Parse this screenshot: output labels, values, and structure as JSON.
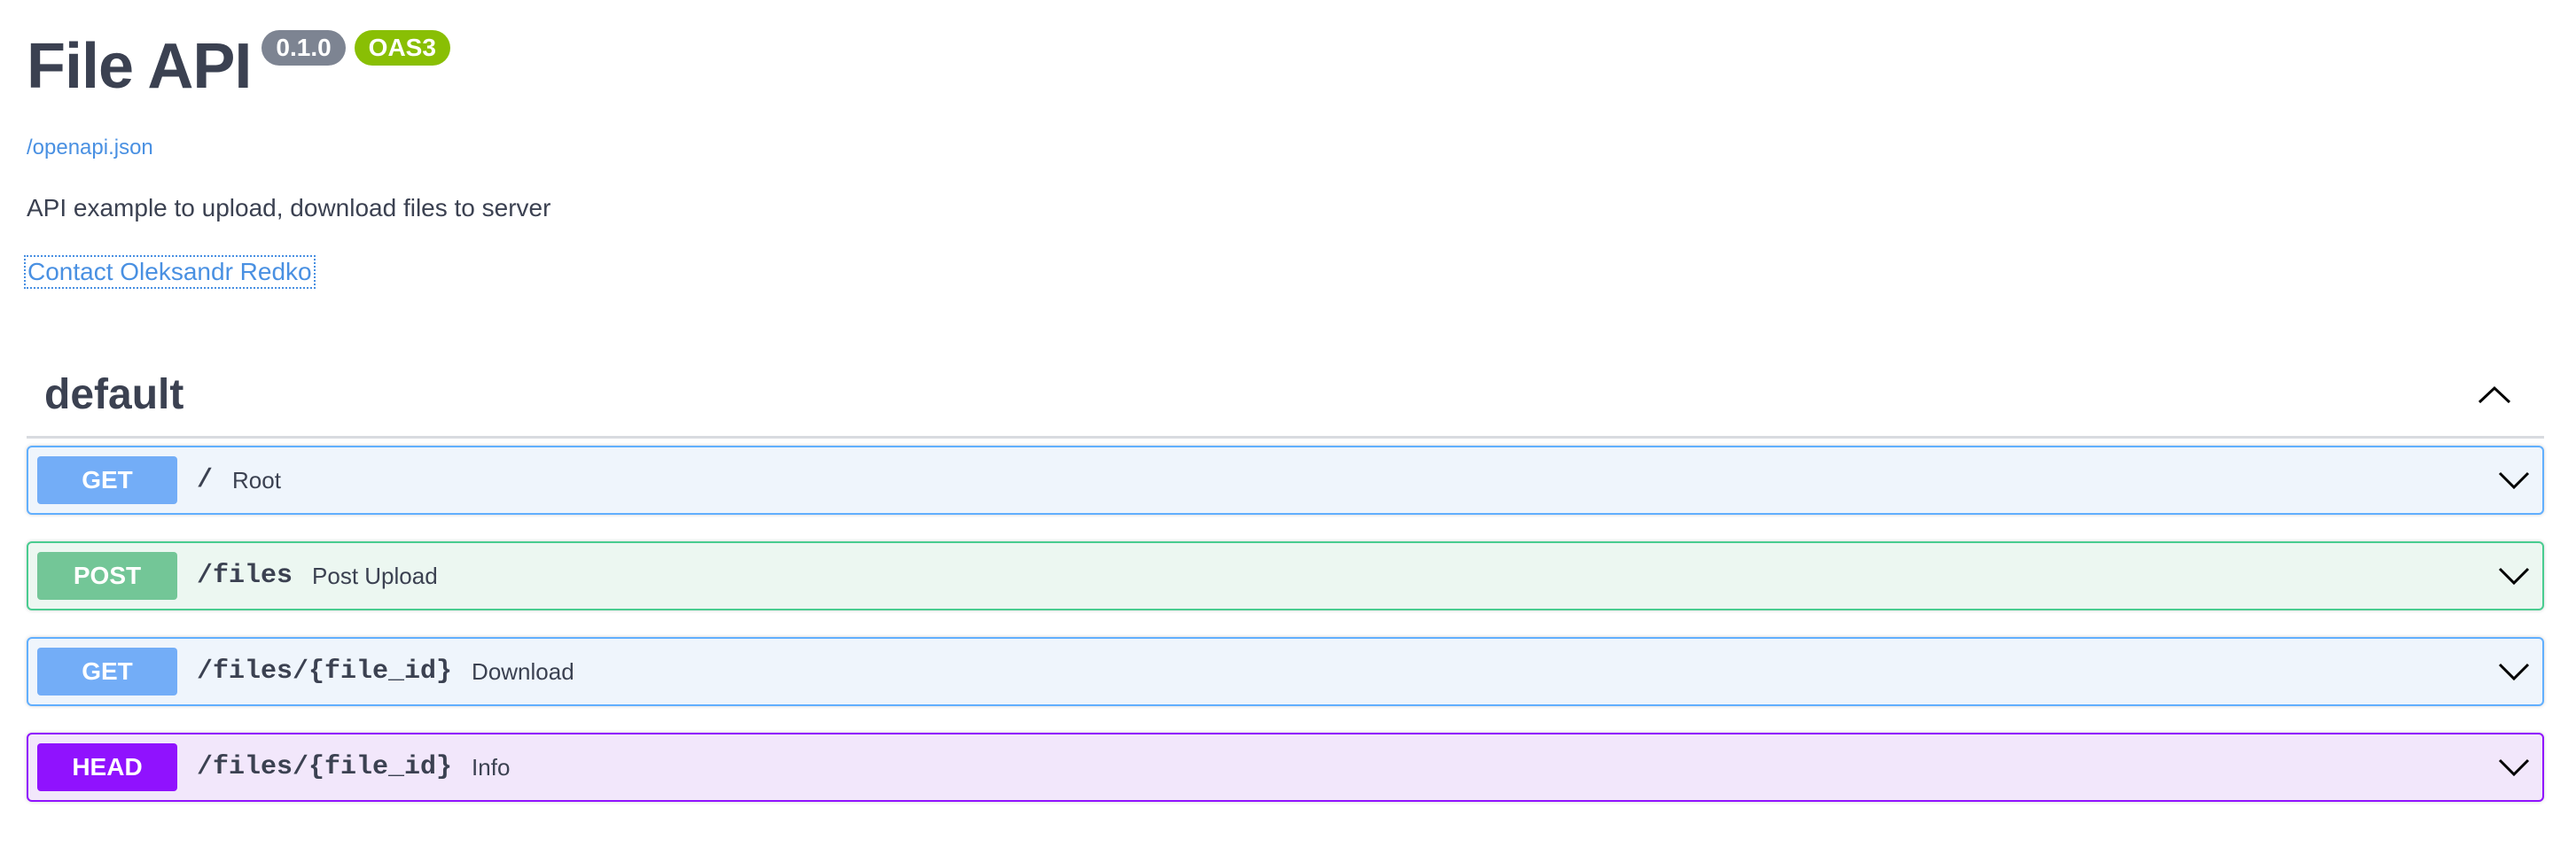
{
  "info": {
    "title": "File API",
    "version": "0.1.0",
    "oas_badge": "OAS3",
    "spec_link": "/openapi.json",
    "description": "API example to upload, download files to server",
    "contact": "Contact Oleksandr Redko"
  },
  "tag": {
    "name": "default",
    "operations": [
      {
        "method": "GET",
        "path": "/",
        "summary": "Root"
      },
      {
        "method": "POST",
        "path": "/files",
        "summary": "Post Upload"
      },
      {
        "method": "GET",
        "path": "/files/{file_id}",
        "summary": "Download"
      },
      {
        "method": "HEAD",
        "path": "/files/{file_id}",
        "summary": "Info"
      }
    ]
  },
  "colors": {
    "get": "#61affe",
    "post": "#49cc90",
    "head": "#9012fe",
    "link": "#4990e2",
    "version_badge": "#7d8492",
    "oas_badge": "#89bf04"
  },
  "icons": {
    "collapse": "chevron-up-icon",
    "expand": "chevron-down-icon"
  }
}
